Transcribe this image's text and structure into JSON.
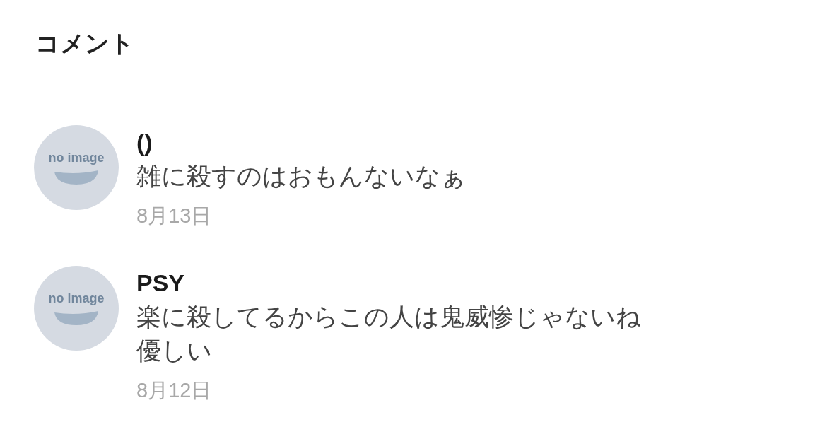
{
  "section": {
    "title": "コメント"
  },
  "comments": [
    {
      "avatar_text": "no image",
      "name": "()",
      "text": "雑に殺すのはおもんないなぁ",
      "date": "8月13日"
    },
    {
      "avatar_text": "no image",
      "name": "PSY",
      "text": "楽に殺してるからこの人は鬼威惨じゃないね優しい",
      "date": "8月12日"
    }
  ]
}
